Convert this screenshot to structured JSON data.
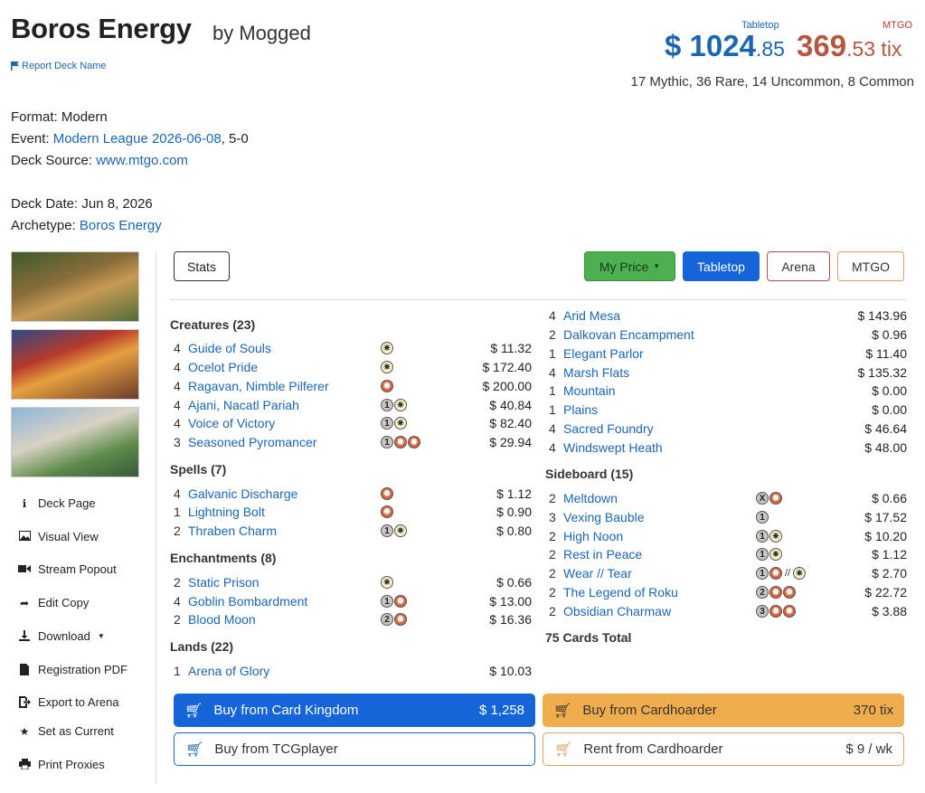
{
  "header": {
    "title": "Boros Energy",
    "byline": "by Mogged",
    "report_link": "Report Deck Name",
    "price_tabletop_label": "Tabletop",
    "price_mtgo_label": "MTGO",
    "price_tabletop_main": "$ 1024",
    "price_tabletop_dec": ".85",
    "price_mtgo_main": "369",
    "price_mtgo_dec": ".53 tix",
    "rarity_summary": "17 Mythic, 36 Rare, 14 Uncommon, 8 Common"
  },
  "meta": {
    "format_label": "Format:",
    "format_value": "Modern",
    "event_label": "Event:",
    "event_link": "Modern League 2026-06-08",
    "event_result": ", 5-0",
    "source_label": "Deck Source:",
    "source_link": "www.mtgo.com",
    "date_label": "Deck Date:",
    "date_value": "Jun 8, 2026",
    "archetype_label": "Archetype:",
    "archetype_link": "Boros Energy"
  },
  "sidebar": {
    "items": [
      {
        "label": "Deck Page",
        "icon": "info-icon"
      },
      {
        "label": "Visual View",
        "icon": "image-icon"
      },
      {
        "label": "Stream Popout",
        "icon": "video-icon"
      },
      {
        "label": "Edit Copy",
        "icon": "share-icon"
      },
      {
        "label": "Download",
        "icon": "download-icon"
      },
      {
        "label": "Registration PDF",
        "icon": "pdf-icon"
      },
      {
        "label": "Export to Arena",
        "icon": "export-icon"
      },
      {
        "label": "Set as Current",
        "icon": "star-icon"
      },
      {
        "label": "Print Proxies",
        "icon": "print-icon"
      }
    ]
  },
  "toolbar": {
    "stats": "Stats",
    "my_price": "My Price",
    "tabletop": "Tabletop",
    "arena": "Arena",
    "mtgo": "MTGO"
  },
  "deck": {
    "creatures_header": "Creatures (23)",
    "creatures": [
      {
        "qty": "4",
        "name": "Guide of Souls",
        "price": "$ 11.32"
      },
      {
        "qty": "4",
        "name": "Ocelot Pride",
        "price": "$ 172.40"
      },
      {
        "qty": "4",
        "name": "Ragavan, Nimble Pilferer",
        "price": "$ 200.00"
      },
      {
        "qty": "4",
        "name": "Ajani, Nacatl Pariah",
        "price": "$ 40.84"
      },
      {
        "qty": "4",
        "name": "Voice of Victory",
        "price": "$ 82.40"
      },
      {
        "qty": "3",
        "name": "Seasoned Pyromancer",
        "price": "$ 29.94"
      }
    ],
    "spells_header": "Spells (7)",
    "spells": [
      {
        "qty": "4",
        "name": "Galvanic Discharge",
        "price": "$ 1.12"
      },
      {
        "qty": "1",
        "name": "Lightning Bolt",
        "price": "$ 0.90"
      },
      {
        "qty": "2",
        "name": "Thraben Charm",
        "price": "$ 0.80"
      }
    ],
    "enchantments_header": "Enchantments (8)",
    "enchantments": [
      {
        "qty": "2",
        "name": "Static Prison",
        "price": "$ 0.66"
      },
      {
        "qty": "4",
        "name": "Goblin Bombardment",
        "price": "$ 13.00"
      },
      {
        "qty": "2",
        "name": "Blood Moon",
        "price": "$ 16.36"
      }
    ],
    "lands_header": "Lands (22)",
    "lands": [
      {
        "qty": "1",
        "name": "Arena of Glory",
        "price": "$ 10.03"
      },
      {
        "qty": "4",
        "name": "Arid Mesa",
        "price": "$ 143.96"
      },
      {
        "qty": "2",
        "name": "Dalkovan Encampment",
        "price": "$ 0.96"
      },
      {
        "qty": "1",
        "name": "Elegant Parlor",
        "price": "$ 11.40"
      },
      {
        "qty": "4",
        "name": "Marsh Flats",
        "price": "$ 135.32"
      },
      {
        "qty": "1",
        "name": "Mountain",
        "price": "$ 0.00"
      },
      {
        "qty": "1",
        "name": "Plains",
        "price": "$ 0.00"
      },
      {
        "qty": "4",
        "name": "Sacred Foundry",
        "price": "$ 46.64"
      },
      {
        "qty": "4",
        "name": "Windswept Heath",
        "price": "$ 48.00"
      }
    ],
    "sideboard_header": "Sideboard (15)",
    "sideboard": [
      {
        "qty": "2",
        "name": "Meltdown",
        "price": "$ 0.66"
      },
      {
        "qty": "3",
        "name": "Vexing Bauble",
        "price": "$ 17.52"
      },
      {
        "qty": "2",
        "name": "High Noon",
        "price": "$ 10.20"
      },
      {
        "qty": "2",
        "name": "Rest in Peace",
        "price": "$ 1.12"
      },
      {
        "qty": "2",
        "name": "Wear // Tear",
        "price": "$ 2.70"
      },
      {
        "qty": "2",
        "name": "The Legend of Roku",
        "price": "$ 22.72"
      },
      {
        "qty": "2",
        "name": "Obsidian Charmaw",
        "price": "$ 3.88"
      }
    ],
    "total": "75 Cards Total"
  },
  "mana": {
    "x": "X",
    "one": "1",
    "two": "2",
    "three": "3",
    "slash": "//"
  },
  "buy": {
    "ck_label": "Buy from Card Kingdom",
    "ck_value": "$ 1,258",
    "ch_label": "Buy from Cardhoarder",
    "ch_value": "370 tix",
    "tcg_label": "Buy from TCGplayer",
    "rent_label": "Rent from Cardhoarder",
    "rent_value": "$ 9 / wk"
  },
  "colors": {
    "tabletop_blue": "#1565d8",
    "mtgo_red": "#b5573f",
    "my_price_green": "#4caf50",
    "cardhoarder_orange": "#f0ad4e",
    "link_blue": "#1a66b3"
  }
}
